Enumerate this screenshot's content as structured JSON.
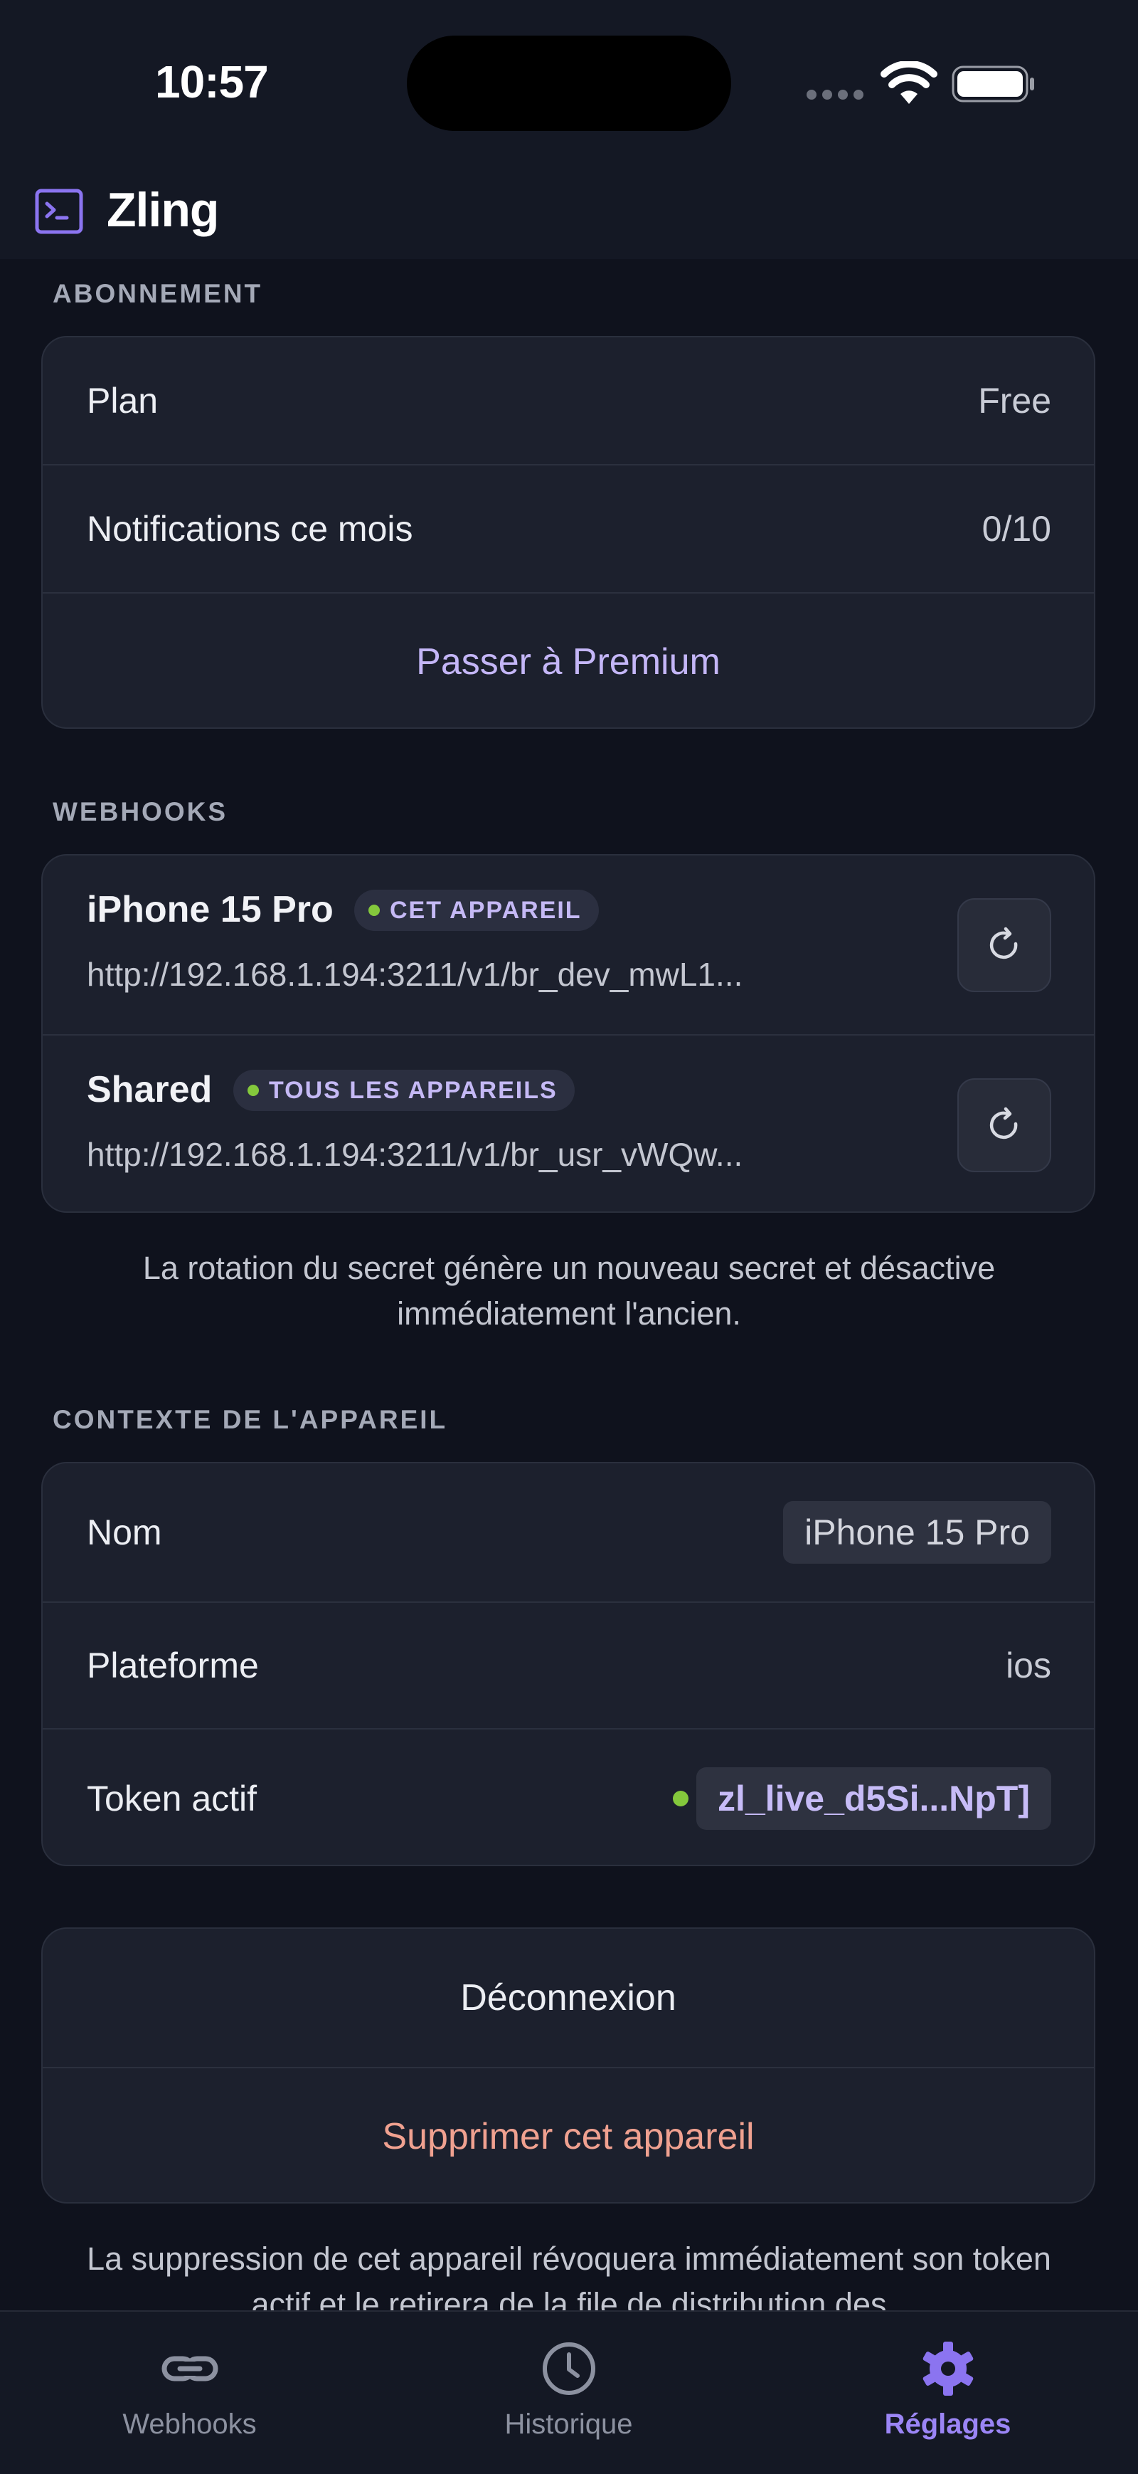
{
  "status_bar": {
    "time": "10:57"
  },
  "app": {
    "title": "Zling",
    "logo_icon": "terminal-icon",
    "accent_color": "#8b74f0"
  },
  "subscription": {
    "section_label": "ABONNEMENT",
    "plan_label": "Plan",
    "plan_value": "Free",
    "notifications_label": "Notifications ce mois",
    "notifications_value": "0/10",
    "upgrade_label": "Passer à Premium"
  },
  "webhooks": {
    "section_label": "WEBHOOKS",
    "items": [
      {
        "name": "iPhone 15 Pro",
        "badge": "CET APPAREIL",
        "url": "http://192.168.1.194:3211/v1/br_dev_mwL1...",
        "icon": "refresh-icon"
      },
      {
        "name": "Shared",
        "badge": "TOUS LES APPAREILS",
        "url": "http://192.168.1.194:3211/v1/br_usr_vWQw...",
        "icon": "refresh-icon"
      }
    ],
    "note": "La rotation du secret génère un nouveau secret et désactive immédiatement l'ancien."
  },
  "device_context": {
    "section_label": "CONTEXTE DE L'APPAREIL",
    "name_label": "Nom",
    "name_value": "iPhone 15 Pro",
    "platform_label": "Plateforme",
    "platform_value": "ios",
    "token_label": "Token actif",
    "token_value": "zl_live_d5Si...NpT]"
  },
  "account_actions": {
    "logout_label": "Déconnexion",
    "delete_label": "Supprimer cet appareil",
    "delete_color": "#f0a190",
    "note": "La suppression de cet appareil révoquera immédiatement son token actif et le retirera de la file de distribution des"
  },
  "tabs": [
    {
      "label": "Webhooks",
      "icon": "link-icon",
      "active": false
    },
    {
      "label": "Historique",
      "icon": "clock-icon",
      "active": false
    },
    {
      "label": "Réglages",
      "icon": "gear-icon",
      "active": true
    }
  ]
}
